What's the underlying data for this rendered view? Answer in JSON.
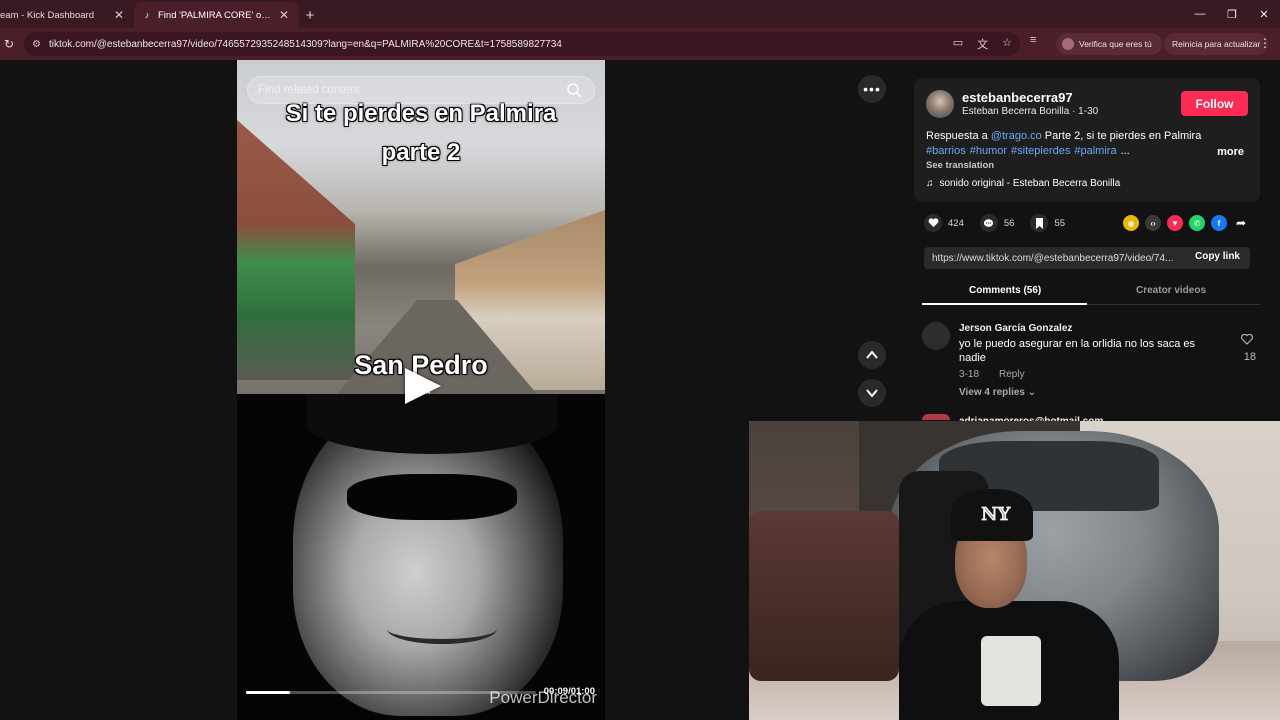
{
  "browser": {
    "tabs": [
      {
        "title": "eam - Kick Dashboard",
        "active": false
      },
      {
        "title": "Find 'PALMIRA CORE' on TikTok",
        "active": true
      }
    ],
    "url": "tiktok.com/@estebanbecerra97/video/7465572935248514309?lang=en&q=PALMIRA%20CORE&t=1758589827734",
    "verify_label": "Verifica que eres tú",
    "update_label": "Reinicia para actualizar",
    "accent": "#4a1f29"
  },
  "video": {
    "search_placeholder": "Find related content",
    "caption_line1": "Si te pierdes en Palmira",
    "caption_line2": "parte 2",
    "caption_place": "San Pedro",
    "timecode": "00:09/01:00",
    "progress_fraction": 0.15,
    "watermark": "PowerDirector"
  },
  "author": {
    "username": "estebanbecerra97",
    "display_name": "Esteban Becerra Bonilla · 1-30",
    "follow_label": "Follow",
    "follow_color": "#fe2c55"
  },
  "description": {
    "prefix": "Respuesta a ",
    "mention": "@trago.co",
    "text": " Parte 2, si te pierdes en Palmira",
    "hashtags": [
      "#barrios",
      "#humor",
      "#sitepierdes",
      "#palmira"
    ],
    "ellipsis": "...",
    "more_label": "more",
    "see_translation": "See translation",
    "sound": "sonido original - Esteban Becerra Bonilla"
  },
  "actions": {
    "likes": "424",
    "comments": "56",
    "saves": "55"
  },
  "share": {
    "link": "https://www.tiktok.com/@estebanbecerra97/video/74...",
    "copy_label": "Copy link"
  },
  "panel_tabs": {
    "comments": "Comments (56)",
    "creator": "Creator videos"
  },
  "comments": [
    {
      "name": "Jerson García Gonzalez",
      "text": "yo le puedo asegurar en la orlidia no los saca es nadie",
      "date": "3-18",
      "reply_label": "Reply",
      "view_replies": "View 4 replies",
      "likes": "18"
    },
    {
      "name": "adrianamoreros@hotmail.com"
    }
  ]
}
